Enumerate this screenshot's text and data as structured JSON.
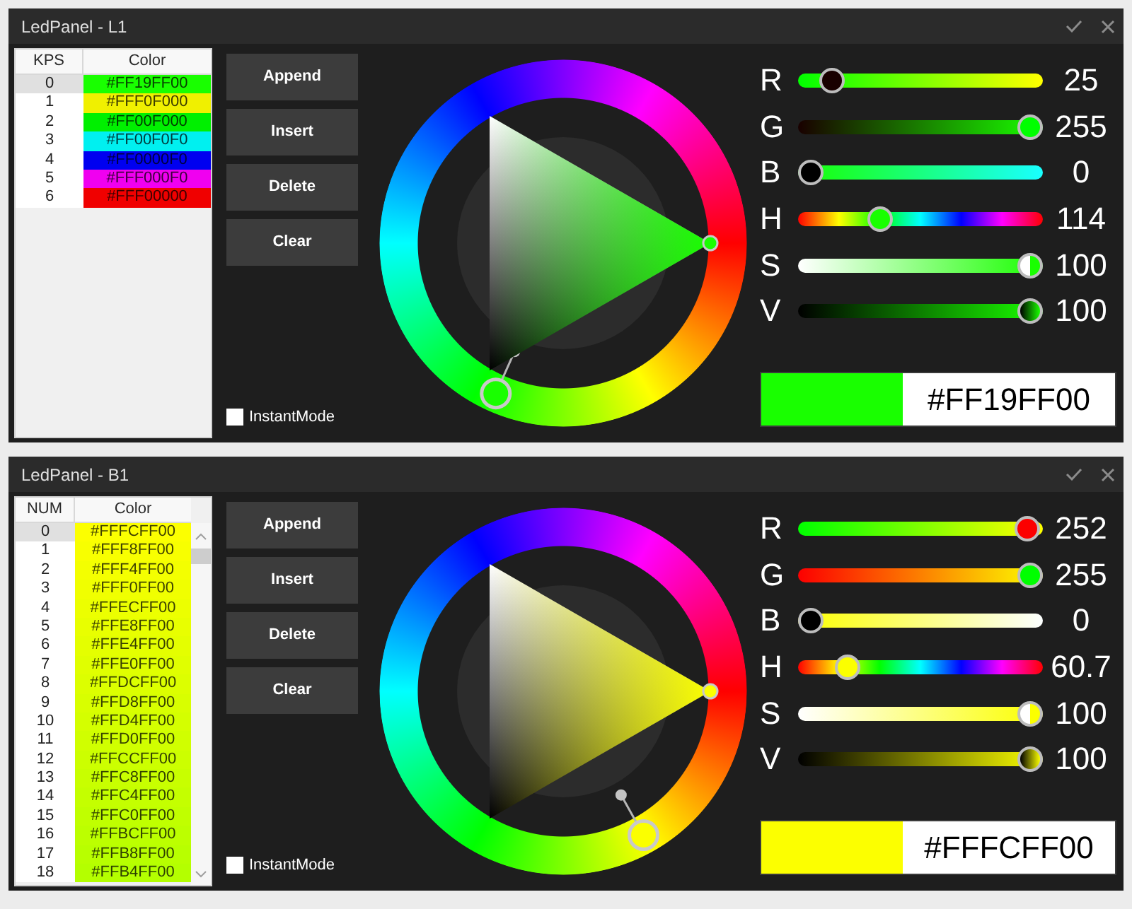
{
  "windows": [
    {
      "title": "LedPanel - L1",
      "table": {
        "columns": [
          "KPS",
          "Color"
        ],
        "rows": [
          {
            "index": "0",
            "value": "#FF19FF00",
            "color": "#19ff00",
            "selected": true
          },
          {
            "index": "1",
            "value": "#FFF0F000",
            "color": "#f0f000",
            "selected": false
          },
          {
            "index": "2",
            "value": "#FF00F000",
            "color": "#00f000",
            "selected": false
          },
          {
            "index": "3",
            "value": "#FF00F0F0",
            "color": "#00f0f0",
            "selected": false
          },
          {
            "index": "4",
            "value": "#FF0000F0",
            "color": "#0000f0",
            "selected": false
          },
          {
            "index": "5",
            "value": "#FFF000F0",
            "color": "#f000f0",
            "selected": false
          },
          {
            "index": "6",
            "value": "#FFF00000",
            "color": "#f00000",
            "selected": false
          }
        ]
      },
      "buttons": [
        "Append",
        "Insert",
        "Delete",
        "Clear"
      ],
      "checkbox": {
        "label": "InstantMode",
        "checked": false
      },
      "sliders": [
        {
          "label": "R",
          "kind": "red",
          "level": 0.098,
          "reading": "25"
        },
        {
          "label": "G",
          "kind": "green",
          "level": 1,
          "reading": "255"
        },
        {
          "label": "B",
          "kind": "blue",
          "level": 0,
          "reading": "0"
        },
        {
          "label": "H",
          "kind": "hue",
          "level": 0.317,
          "reading": "114"
        },
        {
          "label": "S",
          "kind": "saturation",
          "level": 1,
          "reading": "100"
        },
        {
          "label": "V",
          "kind": "value",
          "level": 1,
          "reading": "100"
        }
      ],
      "preview": {
        "hex": "#FF19FF00"
      }
    },
    {
      "title": "LedPanel - B1",
      "table": {
        "columns": [
          "NUM",
          "Color"
        ],
        "scrollbar": true,
        "rows": [
          {
            "index": "0",
            "value": "#FFFCFF00",
            "color": "#fcff00",
            "selected": true
          },
          {
            "index": "1",
            "value": "#FFF8FF00",
            "color": "#f8ff00",
            "selected": false
          },
          {
            "index": "2",
            "value": "#FFF4FF00",
            "color": "#f4ff00",
            "selected": false
          },
          {
            "index": "3",
            "value": "#FFF0FF00",
            "color": "#f0ff00",
            "selected": false
          },
          {
            "index": "4",
            "value": "#FFECFF00",
            "color": "#ecff00",
            "selected": false
          },
          {
            "index": "5",
            "value": "#FFE8FF00",
            "color": "#e8ff00",
            "selected": false
          },
          {
            "index": "6",
            "value": "#FFE4FF00",
            "color": "#e4ff00",
            "selected": false
          },
          {
            "index": "7",
            "value": "#FFE0FF00",
            "color": "#e0ff00",
            "selected": false
          },
          {
            "index": "8",
            "value": "#FFDCFF00",
            "color": "#dcff00",
            "selected": false
          },
          {
            "index": "9",
            "value": "#FFD8FF00",
            "color": "#d8ff00",
            "selected": false
          },
          {
            "index": "10",
            "value": "#FFD4FF00",
            "color": "#d4ff00",
            "selected": false
          },
          {
            "index": "11",
            "value": "#FFD0FF00",
            "color": "#d0ff00",
            "selected": false
          },
          {
            "index": "12",
            "value": "#FFCCFF00",
            "color": "#ccff00",
            "selected": false
          },
          {
            "index": "13",
            "value": "#FFC8FF00",
            "color": "#c8ff00",
            "selected": false
          },
          {
            "index": "14",
            "value": "#FFC4FF00",
            "color": "#c4ff00",
            "selected": false
          },
          {
            "index": "15",
            "value": "#FFC0FF00",
            "color": "#c0ff00",
            "selected": false
          },
          {
            "index": "16",
            "value": "#FFBCFF00",
            "color": "#bcff00",
            "selected": false
          },
          {
            "index": "17",
            "value": "#FFB8FF00",
            "color": "#b8ff00",
            "selected": false
          },
          {
            "index": "18",
            "value": "#FFB4FF00",
            "color": "#b4ff00",
            "selected": false
          }
        ]
      },
      "buttons": [
        "Append",
        "Insert",
        "Delete",
        "Clear"
      ],
      "checkbox": {
        "label": "InstantMode",
        "checked": false
      },
      "sliders": [
        {
          "label": "R",
          "kind": "red",
          "level": 0.988,
          "reading": "252"
        },
        {
          "label": "G",
          "kind": "green",
          "level": 1,
          "reading": "255"
        },
        {
          "label": "B",
          "kind": "blue",
          "level": 0,
          "reading": "0"
        },
        {
          "label": "H",
          "kind": "hue",
          "level": 0.169,
          "reading": "60.7"
        },
        {
          "label": "S",
          "kind": "saturation",
          "level": 1,
          "reading": "100"
        },
        {
          "label": "V",
          "kind": "value",
          "level": 1,
          "reading": "100"
        }
      ],
      "preview": {
        "hex": "#FFFCFF00"
      }
    }
  ]
}
